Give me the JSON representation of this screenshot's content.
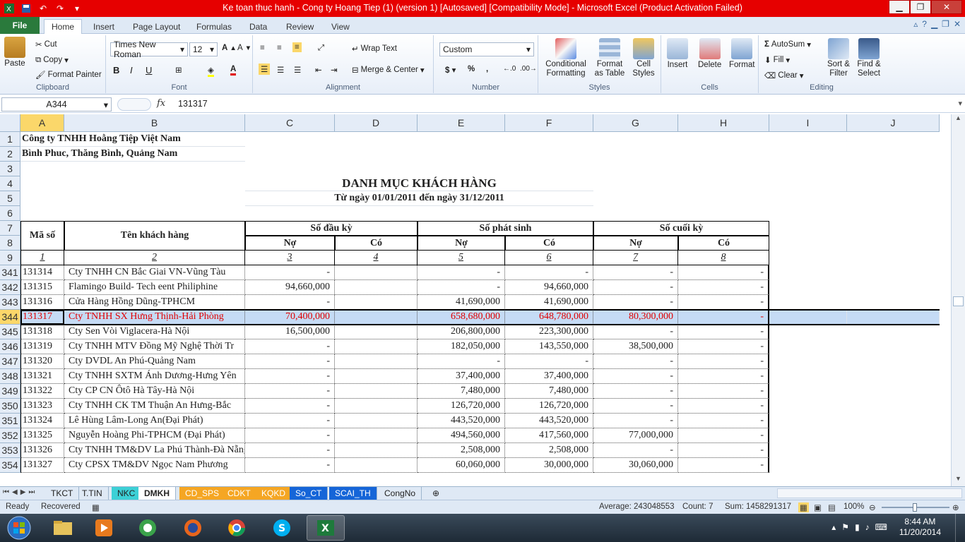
{
  "window": {
    "title": "Ke toan thuc hanh - Cong ty Hoang Tiep (1) (version 1) [Autosaved]  [Compatibility Mode] -  Microsoft Excel (Product Activation Failed)"
  },
  "ribbon_tabs": [
    "File",
    "Home",
    "Insert",
    "Page Layout",
    "Formulas",
    "Data",
    "Review",
    "View"
  ],
  "ribbon": {
    "clipboard": {
      "paste": "Paste",
      "cut": "Cut",
      "copy": "Copy",
      "format_painter": "Format Painter",
      "label": "Clipboard"
    },
    "font": {
      "name": "Times New Roman",
      "size": "12",
      "label": "Font"
    },
    "alignment": {
      "wrap": "Wrap Text",
      "merge": "Merge & Center",
      "label": "Alignment"
    },
    "number": {
      "format": "Custom",
      "label": "Number"
    },
    "styles": {
      "conditional": "Conditional Formatting",
      "format_table": "Format as Table",
      "cell_styles": "Cell Styles",
      "label": "Styles"
    },
    "cells": {
      "insert": "Insert",
      "delete": "Delete",
      "format": "Format",
      "label": "Cells"
    },
    "editing": {
      "autosum": "AutoSum",
      "fill": "Fill",
      "clear": "Clear",
      "sort": "Sort & Filter",
      "find": "Find & Select",
      "label": "Editing"
    }
  },
  "formula_bar": {
    "name_box": "A344",
    "fx": "fx",
    "content": "131317"
  },
  "columns": [
    "A",
    "B",
    "C",
    "D",
    "E",
    "F",
    "G",
    "H",
    "I",
    "J"
  ],
  "sheet": {
    "company": "Công ty TNHH Hoằng Tiệp Việt Nam",
    "address": "Bình Phuc, Thăng Bình, Quảng Nam",
    "title": "DANH MỤC KHÁCH HÀNG",
    "period": "Từ ngày 01/01/2011 đến ngày 31/12/2011",
    "hdr_code": "Mã số",
    "hdr_name": "Tên khách hàng",
    "hdr_open": "Số đầu kỳ",
    "hdr_arising": "Số phát sinh",
    "hdr_close": "Số cuối kỳ",
    "debit": "Nợ",
    "credit": "Có",
    "idx": [
      "1",
      "2",
      "3",
      "4",
      "5",
      "6",
      "7",
      "8"
    ],
    "top_rows": [
      "1",
      "2",
      "3",
      "4",
      "5",
      "6",
      "7",
      "8",
      "9"
    ],
    "rows": [
      {
        "row": "341",
        "code": "131314",
        "name": "Cty TNHH CN Bắc Giai VN-Vũng Tàu",
        "c": "-",
        "d": "",
        "e": "-",
        "f": "-",
        "g": "-",
        "h": "-"
      },
      {
        "row": "342",
        "code": "131315",
        "name": "Flamingo Build- Tech eent Philiphine",
        "c": "94,660,000",
        "d": "",
        "e": "-",
        "f": "94,660,000",
        "g": "-",
        "h": "-"
      },
      {
        "row": "343",
        "code": "131316",
        "name": "Cửa Hàng Hồng Dũng-TPHCM",
        "c": "-",
        "d": "",
        "e": "41,690,000",
        "f": "41,690,000",
        "g": "-",
        "h": "-"
      },
      {
        "row": "344",
        "code": "131317",
        "name": "Cty TNHH SX Hưng Thịnh-Hải Phòng",
        "c": "70,400,000",
        "d": "",
        "e": "658,680,000",
        "f": "648,780,000",
        "g": "80,300,000",
        "h": "-"
      },
      {
        "row": "345",
        "code": "131318",
        "name": "Cty Sen Vòi Viglacera-Hà Nội",
        "c": "16,500,000",
        "d": "",
        "e": "206,800,000",
        "f": "223,300,000",
        "g": "-",
        "h": "-"
      },
      {
        "row": "346",
        "code": "131319",
        "name": "Cty TNHH MTV Đồng Mỹ Nghệ Thời Tr",
        "c": "-",
        "d": "",
        "e": "182,050,000",
        "f": "143,550,000",
        "g": "38,500,000",
        "h": "-"
      },
      {
        "row": "347",
        "code": "131320",
        "name": "Cty DVDL An Phú-Quảng Nam",
        "c": "-",
        "d": "",
        "e": "-",
        "f": "-",
        "g": "-",
        "h": "-"
      },
      {
        "row": "348",
        "code": "131321",
        "name": "Cty TNHH SXTM Ánh Dương-Hưng Yên",
        "c": "-",
        "d": "",
        "e": "37,400,000",
        "f": "37,400,000",
        "g": "-",
        "h": "-"
      },
      {
        "row": "349",
        "code": "131322",
        "name": "Cty CP CN Ôtô Hà Tây-Hà Nội",
        "c": "-",
        "d": "",
        "e": "7,480,000",
        "f": "7,480,000",
        "g": "-",
        "h": "-"
      },
      {
        "row": "350",
        "code": "131323",
        "name": "Cty TNHH CK TM Thuận An Hưng-Bắc",
        "c": "-",
        "d": "",
        "e": "126,720,000",
        "f": "126,720,000",
        "g": "-",
        "h": "-"
      },
      {
        "row": "351",
        "code": "131324",
        "name": "Lê Hùng Lâm-Long An(Đại Phát)",
        "c": "-",
        "d": "",
        "e": "443,520,000",
        "f": "443,520,000",
        "g": "-",
        "h": "-"
      },
      {
        "row": "352",
        "code": "131325",
        "name": "Nguyễn Hoàng Phi-TPHCM (Đại Phát)",
        "c": "-",
        "d": "",
        "e": "494,560,000",
        "f": "417,560,000",
        "g": "77,000,000",
        "h": "-"
      },
      {
        "row": "353",
        "code": "131326",
        "name": "Cty TNHH TM&DV La Phú Thành-Đà Nẵng",
        "c": "-",
        "d": "",
        "e": "2,508,000",
        "f": "2,508,000",
        "g": "-",
        "h": "-"
      },
      {
        "row": "354",
        "code": "131327",
        "name": "Cty CPSX TM&DV Ngọc Nam Phương",
        "c": "-",
        "d": "",
        "e": "60,060,000",
        "f": "30,000,000",
        "g": "30,060,000",
        "h": "-"
      }
    ]
  },
  "sheet_tabs": [
    "TKCT",
    "T.TIN",
    "NKC",
    "DMKH",
    "CD_SPS",
    "CDKT",
    "KQKD",
    "So_CT",
    "SCAI_TH",
    "CongNo"
  ],
  "status": {
    "ready": "Ready",
    "recovered": "Recovered",
    "average": "Average: 243048553",
    "count": "Count: 7",
    "sum": "Sum: 1458291317",
    "zoom": "100%"
  },
  "taskbar": {
    "time": "8:44 AM",
    "date": "11/20/2014"
  },
  "colors": {
    "title_bar": "#e60000",
    "file_tab": "#2a7a3c",
    "selected_row_text": "#e00000",
    "selected_row_bg": "#c5dbf5"
  }
}
